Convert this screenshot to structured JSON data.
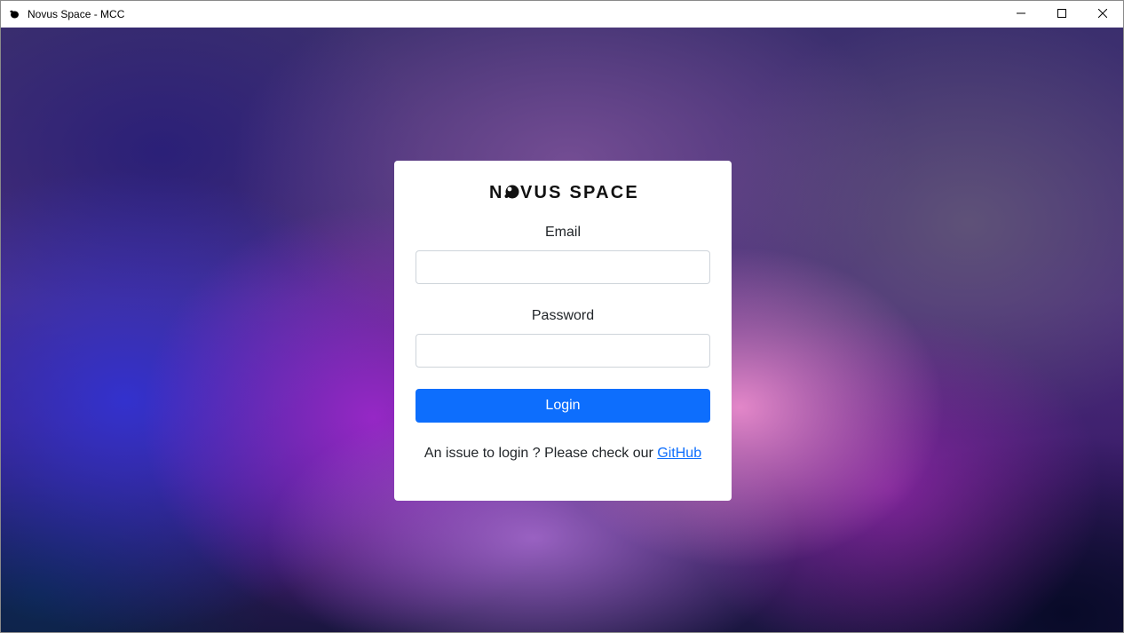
{
  "window": {
    "title": "Novus Space - MCC",
    "icon": "app-icon",
    "controls": [
      "minimize-icon",
      "maximize-icon",
      "close-icon"
    ]
  },
  "logo": {
    "text": "NOVUS SPACE"
  },
  "form": {
    "email_label": "Email",
    "email_value": "",
    "password_label": "Password",
    "password_value": "",
    "login_label": "Login"
  },
  "help": {
    "text": "An issue to login ? Please check our",
    "link_text": "GitHub"
  },
  "colors": {
    "primary": "#0d6efd",
    "card_bg": "#ffffff",
    "text": "#212529"
  }
}
